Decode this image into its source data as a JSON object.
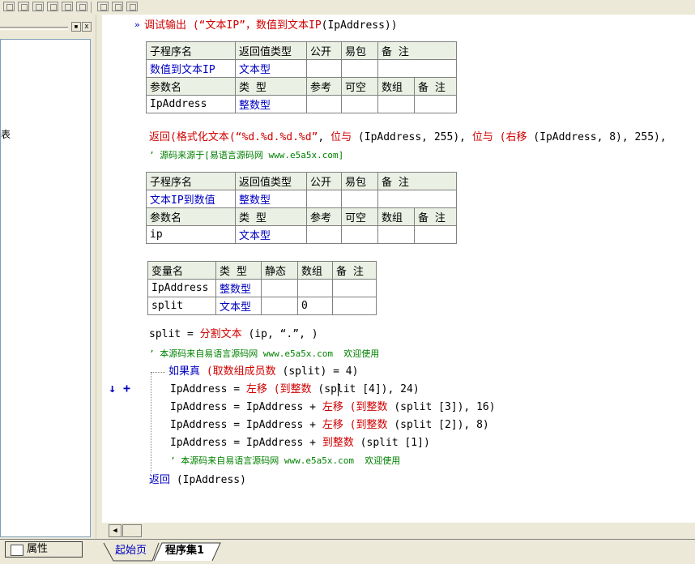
{
  "toolbar": {
    "icons": [
      "align-left-icon",
      "align-center-icon",
      "align-right-icon",
      "align-top-icon",
      "h-distribute-icon",
      "v-distribute-icon",
      "equal-width-icon",
      "equal-height-icon",
      "equal-size-icon"
    ]
  },
  "left_panel": {
    "btn_pin": "▪",
    "btn_close": "x",
    "tree_fragment": "表"
  },
  "code": {
    "header_call": {
      "fn": "调试输出",
      "arg_text": "“文本IP”",
      "sep": "，",
      "call": "数值到文本IP",
      "arg": "(IpAddress)",
      "close": ")"
    },
    "sub1": {
      "headers": [
        "子程序名",
        "返回值类型",
        "公开",
        "易包",
        "备 注"
      ],
      "name": "数值到文本IP",
      "ret_type": "文本型",
      "param_headers": [
        "参数名",
        "类 型",
        "参考",
        "可空",
        "数组",
        "备 注"
      ],
      "param_name": "IpAddress",
      "param_type": "整数型"
    },
    "return1": {
      "kw": "返回",
      "fn1": "(格式化文本",
      "str": "(“%d.%d.%d.%d”",
      "sep1": ", ",
      "fn2": "位与",
      "args2": " (IpAddress, 255), ",
      "fn3": "位与",
      "fn4": " (右移",
      "args3": " (IpAddress, 8), 255),"
    },
    "comment1": "’ 源码来源于[易语言源码网 www.e5a5x.com]",
    "sub2": {
      "headers": [
        "子程序名",
        "返回值类型",
        "公开",
        "易包",
        "备 注"
      ],
      "name": "文本IP到数值",
      "ret_type": "整数型",
      "param_headers": [
        "参数名",
        "类 型",
        "参考",
        "可空",
        "数组",
        "备 注"
      ],
      "param_name": "ip",
      "param_type": "文本型"
    },
    "vars": {
      "headers": [
        "变量名",
        "类 型",
        "静态",
        "数组",
        "备 注"
      ],
      "rows": [
        {
          "name": "IpAddress",
          "type": "整数型",
          "static": "",
          "array": "",
          "note": ""
        },
        {
          "name": "split",
          "type": "文本型",
          "static": "",
          "array": "0",
          "note": ""
        }
      ]
    },
    "split_line": {
      "lhs": "split = ",
      "fn": "分割文本",
      "args": " (ip, “.”, )"
    },
    "comment2": "’ 本源码来自易语言源码网 www.e5a5x.com  欢迎使用",
    "if_line": {
      "kw": "如果真",
      "fn": " (取数组成员数",
      "args": " (split) = 4)"
    },
    "stmt1": {
      "lhs": "IpAddress = ",
      "fn1": "左移",
      "fn2": " (到整数",
      "args": " (split [4]), 24)"
    },
    "stmt2": {
      "lhs": "IpAddress = IpAddress + ",
      "fn1": "左移",
      "fn2": " (到整数",
      "args": " (split [3]), 16)"
    },
    "stmt3": {
      "lhs": "IpAddress = IpAddress + ",
      "fn1": "左移",
      "fn2": " (到整数",
      "args": " (split [2]), 8)"
    },
    "stmt4": {
      "lhs": "IpAddress = IpAddress + ",
      "fn": "到整数",
      "args": " (split [1])"
    },
    "comment3": "’ 本源码来自易语言源码网 www.e5a5x.com  欢迎使用",
    "return2": {
      "kw": "返回",
      "args": " (IpAddress)"
    }
  },
  "gutter": {
    "run_arrow": "»",
    "down_arrow": "↓",
    "plus": "+"
  },
  "bottom": {
    "properties_tab": "属性",
    "tabs": [
      "起始页",
      "程序集1"
    ]
  },
  "colors": {
    "keyword_red": "#d00000",
    "type_blue": "#0000c0",
    "comment_green": "#008000",
    "table_header_bg": "#eaf0e3"
  }
}
